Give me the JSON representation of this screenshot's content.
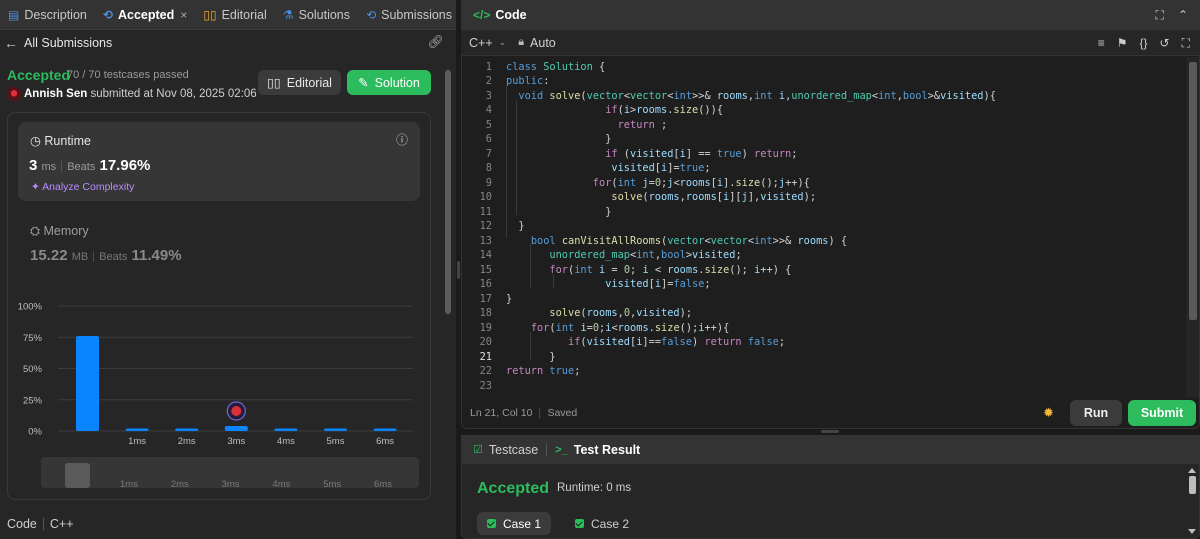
{
  "left_tabs": [
    {
      "label": "Description",
      "icon": "description-icon"
    },
    {
      "label": "Accepted",
      "icon": "history-icon",
      "close": "×"
    },
    {
      "label": "Editorial",
      "icon": "book-icon"
    },
    {
      "label": "Solutions",
      "icon": "flask-icon"
    },
    {
      "label": "Submissions",
      "icon": "history-icon"
    }
  ],
  "sub_header": {
    "back_label": "All Submissions"
  },
  "submission": {
    "status": "Accepted",
    "testcases": "70 / 70 testcases passed",
    "user": "Annish Sen",
    "submitted_text": "submitted at Nov 08, 2025 02:06",
    "editorial_label": "Editorial",
    "solution_label": "Solution"
  },
  "runtime": {
    "label": "Runtime",
    "value": "3",
    "unit": "ms",
    "beats_label": "Beats",
    "beats_value": "17.96%",
    "analyze_label": "Analyze Complexity"
  },
  "memory": {
    "label": "Memory",
    "value": "15.22",
    "unit": "MB",
    "beats_label": "Beats",
    "beats_value": "11.49%"
  },
  "chart_data": {
    "type": "bar",
    "yticks": [
      "100%",
      "75%",
      "50%",
      "25%",
      "0%"
    ],
    "ylim": [
      0,
      100
    ],
    "categories": [
      "",
      "1ms",
      "2ms",
      "3ms",
      "4ms",
      "5ms",
      "6ms"
    ],
    "values": [
      76,
      2,
      2,
      4,
      2,
      2,
      2
    ],
    "marker_category": "3ms",
    "minimap_labels": [
      "1ms",
      "2ms",
      "3ms",
      "4ms",
      "5ms",
      "6ms"
    ],
    "bar_color": "#0a84ff"
  },
  "left_footer": {
    "code_label": "Code",
    "lang_label": "C++"
  },
  "code_panel": {
    "title": "Code",
    "language": "C++",
    "mode": "Auto",
    "status_position": "Ln 21, Col 10",
    "status_saved": "Saved",
    "run_label": "Run",
    "submit_label": "Submit"
  },
  "test_panel": {
    "testcase_tab": "Testcase",
    "result_tab": "Test Result",
    "status": "Accepted",
    "runtime": "Runtime: 0 ms",
    "cases": [
      "Case 1",
      "Case 2"
    ]
  },
  "colors": {
    "accent_green": "#2cbb5d",
    "bar_blue": "#0a84ff",
    "purple": "#b88cff"
  }
}
